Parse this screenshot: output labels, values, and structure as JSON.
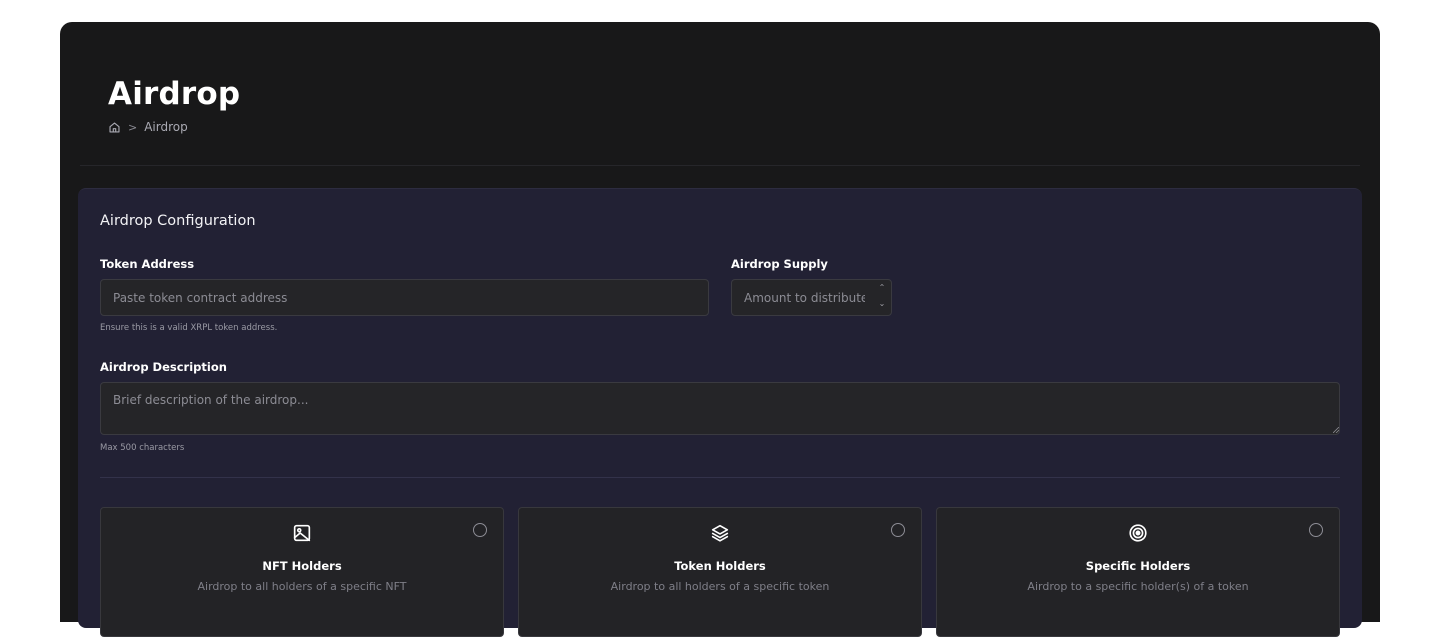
{
  "page": {
    "title": "Airdrop",
    "breadcrumb": {
      "home_icon": "home-icon",
      "separator": ">",
      "current": "Airdrop"
    }
  },
  "config": {
    "title": "Airdrop Configuration",
    "token_address": {
      "label": "Token Address",
      "placeholder": "Paste token contract address",
      "value": "",
      "hint": "Ensure this is a valid XRPL token address."
    },
    "airdrop_supply": {
      "label": "Airdrop Supply",
      "placeholder": "Amount to distribute",
      "value": ""
    },
    "description": {
      "label": "Airdrop Description",
      "placeholder": "Brief description of the airdrop...",
      "value": "",
      "hint": "Max 500 characters"
    }
  },
  "options": [
    {
      "icon": "image-icon",
      "title": "NFT Holders",
      "description": "Airdrop to all holders of a specific NFT",
      "selected": false
    },
    {
      "icon": "layers-icon",
      "title": "Token Holders",
      "description": "Airdrop to all holders of a specific token",
      "selected": false
    },
    {
      "icon": "target-icon",
      "title": "Specific Holders",
      "description": "Airdrop to a specific holder(s) of a token",
      "selected": false
    }
  ]
}
